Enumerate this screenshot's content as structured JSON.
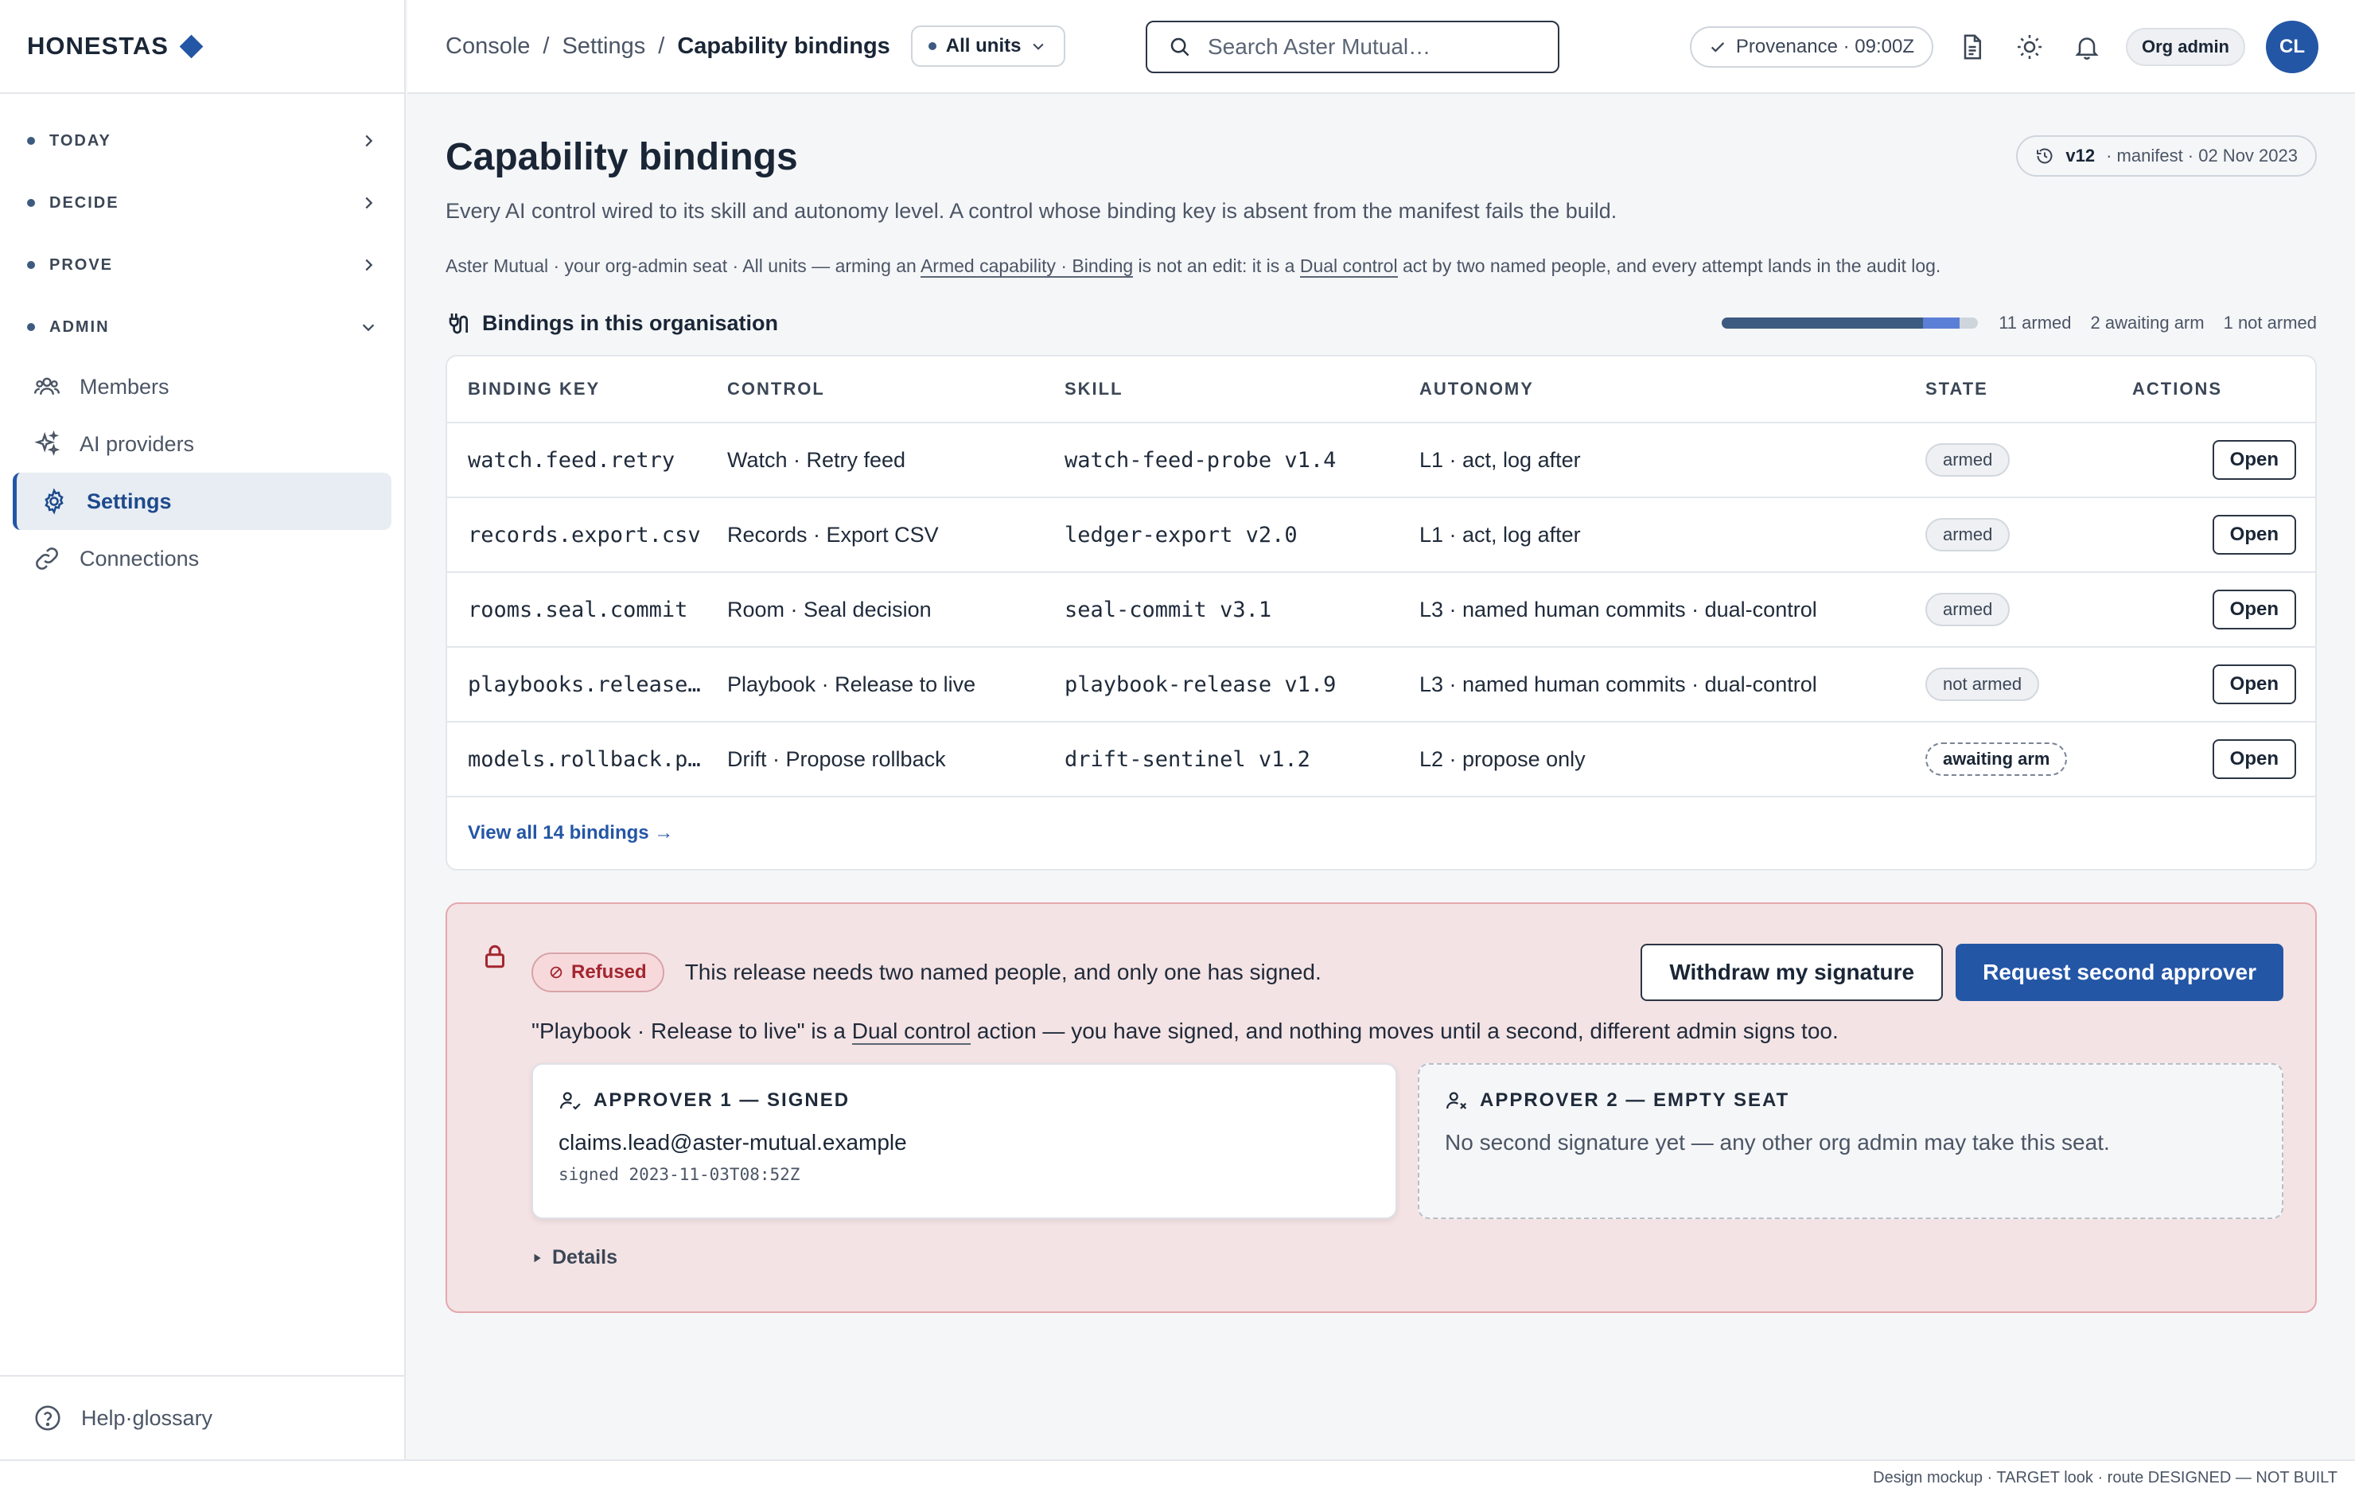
{
  "brand": {
    "name": "HONESTAS",
    "accent": "#2456a6"
  },
  "sidebar": {
    "groups": [
      {
        "label": "TODAY"
      },
      {
        "label": "DECIDE"
      },
      {
        "label": "PROVE"
      },
      {
        "label": "ADMIN"
      }
    ],
    "items": [
      {
        "label": "Members",
        "icon": "users-icon"
      },
      {
        "label": "AI providers",
        "icon": "sparkle-icon"
      },
      {
        "label": "Settings",
        "icon": "gear-icon",
        "active": true
      },
      {
        "label": "Connections",
        "icon": "link-icon"
      }
    ],
    "footer": "Help·glossary"
  },
  "topbar": {
    "breadcrumb": [
      "Console",
      "Settings",
      "Capability bindings"
    ],
    "unit_select": "All units",
    "search_placeholder": "Search Aster Mutual…",
    "provenance": "Provenance · 09:00Z",
    "role": "Org admin",
    "avatar": "CL"
  },
  "page": {
    "title": "Capability bindings",
    "subtitle": "Every AI control wired to its skill and autonomy level. A control whose binding key is absent from the manifest fails the build.",
    "manifest_version": "v12",
    "manifest_meta": "· manifest · 02 Nov 2023",
    "context_a": "Aster Mutual · your org-admin seat · All units — arming an ",
    "context_link1": "Armed capability · Binding",
    "context_b": " is not an edit: it is a ",
    "context_link2": "Dual control",
    "context_c": " act by two named people, and every attempt lands in the audit log."
  },
  "bindings": {
    "title": "Bindings in this organisation",
    "stats": {
      "armed": "11 armed",
      "awaiting": "2 awaiting arm",
      "not_armed": "1 not armed"
    },
    "counts": {
      "armed": 11,
      "awaiting": 2,
      "not_armed": 1
    },
    "columns": [
      "BINDING KEY",
      "CONTROL",
      "SKILL",
      "AUTONOMY",
      "STATE",
      "ACTIONS"
    ],
    "rows": [
      {
        "key": "watch.feed.retry",
        "control": "Watch · Retry feed",
        "skill": "watch-feed-probe v1.4",
        "autonomy": "L1 · act, log after",
        "state": "armed",
        "action": "Open"
      },
      {
        "key": "records.export.csv",
        "control": "Records · Export CSV",
        "skill": "ledger-export v2.0",
        "autonomy": "L1 · act, log after",
        "state": "armed",
        "action": "Open"
      },
      {
        "key": "rooms.seal.commit",
        "control": "Room · Seal decision",
        "skill": "seal-commit v3.1",
        "autonomy": "L3 · named human commits · dual-control",
        "state": "armed",
        "action": "Open"
      },
      {
        "key": "playbooks.release…",
        "control": "Playbook · Release to live",
        "skill": "playbook-release v1.9",
        "autonomy": "L3 · named human commits · dual-control",
        "state": "not armed",
        "action": "Open"
      },
      {
        "key": "models.rollback.p…",
        "control": "Drift · Propose rollback",
        "skill": "drift-sentinel v1.2",
        "autonomy": "L2 · propose only",
        "state": "awaiting arm",
        "action": "Open"
      }
    ],
    "view_all": "View all 14 bindings →"
  },
  "refused": {
    "badge": "Refused",
    "message": "This release needs two named people, and only one has signed.",
    "withdraw": "Withdraw my signature",
    "request": "Request second approver",
    "desc_a": "\"Playbook · Release to live\" is a ",
    "desc_link": "Dual control",
    "desc_b": " action — you have signed, and nothing moves until a second, different admin signs too.",
    "approver1": {
      "heading": "APPROVER 1 — SIGNED",
      "email": "claims.lead@aster-mutual.example",
      "signed": "signed 2023-11-03T08:52Z"
    },
    "approver2": {
      "heading": "APPROVER 2 — EMPTY SEAT",
      "text": "No second signature yet — any other org admin may take this seat."
    },
    "details": "Details"
  },
  "footnote": "Design mockup · TARGET look · route DESIGNED — NOT BUILT"
}
